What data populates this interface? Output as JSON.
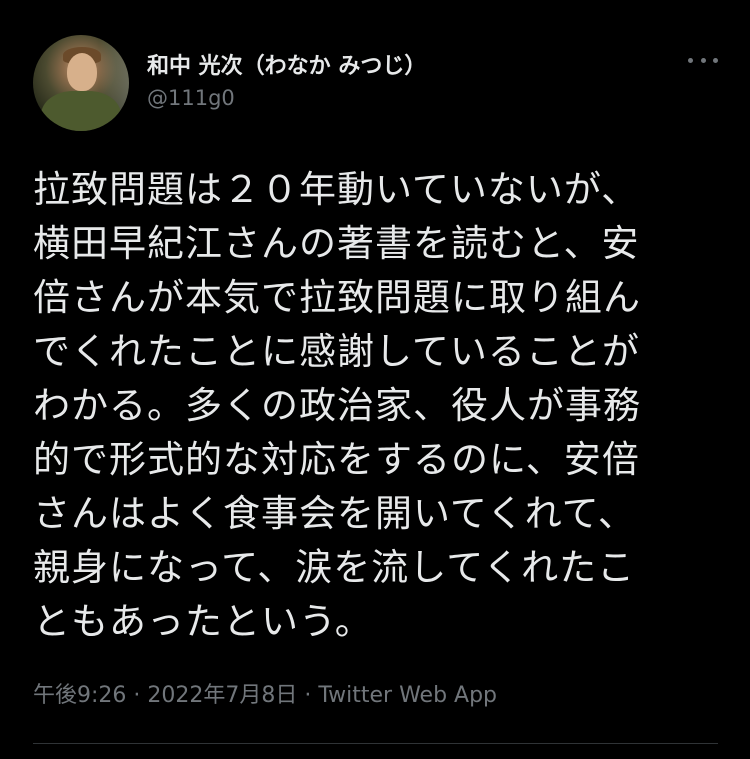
{
  "author": {
    "display_name": "和中 光次（わなか みつじ）",
    "handle": "@111g0"
  },
  "tweet": {
    "lines": [
      "拉致問題は２０年動いていないが、",
      "横田早紀江さんの著書を読むと、安",
      "倍さんが本気で拉致問題に取り組ん",
      "でくれたことに感謝していることが",
      "わかる。多くの政治家、役人が事務",
      "的で形式的な対応をするのに、安倍",
      "さんはよく食事会を開いてくれて、",
      "親身になって、涙を流してくれたこ",
      "ともあったという。"
    ],
    "meta": "午後9:26 · 2022年7月8日 · Twitter Web App"
  },
  "icons": {
    "more": "more-horizontal-icon"
  },
  "colors": {
    "background": "#000000",
    "text_primary": "#e7e9ea",
    "text_secondary": "#71767b",
    "divider": "#2f3336"
  }
}
